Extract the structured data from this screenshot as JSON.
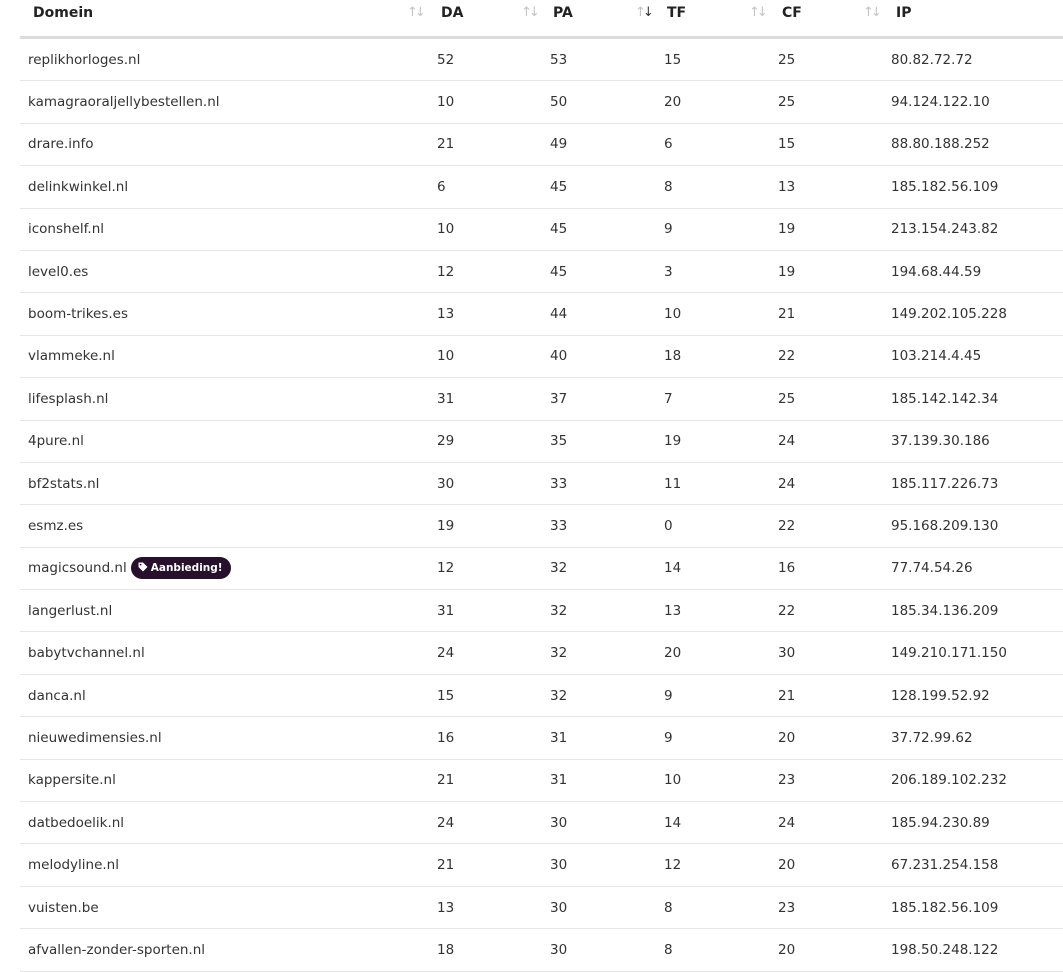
{
  "table": {
    "headers": {
      "domain": "Domein",
      "da": "DA",
      "pa": "PA",
      "tf": "TF",
      "cf": "CF",
      "ip": "IP"
    },
    "sort_icon_up": "↑",
    "sort_icon_down": "↓",
    "rows": [
      {
        "domain": "replikhorloges.nl",
        "da": "52",
        "pa": "53",
        "tf": "15",
        "cf": "25",
        "ip": "80.82.72.72"
      },
      {
        "domain": "kamagraoraljellybestellen.nl",
        "da": "10",
        "pa": "50",
        "tf": "20",
        "cf": "25",
        "ip": "94.124.122.10"
      },
      {
        "domain": "drare.info",
        "da": "21",
        "pa": "49",
        "tf": "6",
        "cf": "15",
        "ip": "88.80.188.252"
      },
      {
        "domain": "delinkwinkel.nl",
        "da": "6",
        "pa": "45",
        "tf": "8",
        "cf": "13",
        "ip": "185.182.56.109"
      },
      {
        "domain": "iconshelf.nl",
        "da": "10",
        "pa": "45",
        "tf": "9",
        "cf": "19",
        "ip": "213.154.243.82"
      },
      {
        "domain": "level0.es",
        "da": "12",
        "pa": "45",
        "tf": "3",
        "cf": "19",
        "ip": "194.68.44.59"
      },
      {
        "domain": "boom-trikes.es",
        "da": "13",
        "pa": "44",
        "tf": "10",
        "cf": "21",
        "ip": "149.202.105.228"
      },
      {
        "domain": "vlammeke.nl",
        "da": "10",
        "pa": "40",
        "tf": "18",
        "cf": "22",
        "ip": "103.214.4.45"
      },
      {
        "domain": "lifesplash.nl",
        "da": "31",
        "pa": "37",
        "tf": "7",
        "cf": "25",
        "ip": "185.142.142.34"
      },
      {
        "domain": "4pure.nl",
        "da": "29",
        "pa": "35",
        "tf": "19",
        "cf": "24",
        "ip": "37.139.30.186"
      },
      {
        "domain": "bf2stats.nl",
        "da": "30",
        "pa": "33",
        "tf": "11",
        "cf": "24",
        "ip": "185.117.226.73"
      },
      {
        "domain": "esmz.es",
        "da": "19",
        "pa": "33",
        "tf": "0",
        "cf": "22",
        "ip": "95.168.209.130"
      },
      {
        "domain": "magicsound.nl",
        "da": "12",
        "pa": "32",
        "tf": "14",
        "cf": "16",
        "ip": "77.74.54.26",
        "badge": "Aanbieding!"
      },
      {
        "domain": "langerlust.nl",
        "da": "31",
        "pa": "32",
        "tf": "13",
        "cf": "22",
        "ip": "185.34.136.209"
      },
      {
        "domain": "babytvchannel.nl",
        "da": "24",
        "pa": "32",
        "tf": "20",
        "cf": "30",
        "ip": "149.210.171.150"
      },
      {
        "domain": "danca.nl",
        "da": "15",
        "pa": "32",
        "tf": "9",
        "cf": "21",
        "ip": "128.199.52.92"
      },
      {
        "domain": "nieuwedimensies.nl",
        "da": "16",
        "pa": "31",
        "tf": "9",
        "cf": "20",
        "ip": "37.72.99.62"
      },
      {
        "domain": "kappersite.nl",
        "da": "21",
        "pa": "31",
        "tf": "10",
        "cf": "23",
        "ip": "206.189.102.232"
      },
      {
        "domain": "datbedoelik.nl",
        "da": "24",
        "pa": "30",
        "tf": "14",
        "cf": "24",
        "ip": "185.94.230.89"
      },
      {
        "domain": "melodyline.nl",
        "da": "21",
        "pa": "30",
        "tf": "12",
        "cf": "20",
        "ip": "67.231.254.158"
      },
      {
        "domain": "vuisten.be",
        "da": "13",
        "pa": "30",
        "tf": "8",
        "cf": "23",
        "ip": "185.182.56.109"
      },
      {
        "domain": "afvallen-zonder-sporten.nl",
        "da": "18",
        "pa": "30",
        "tf": "8",
        "cf": "20",
        "ip": "198.50.248.122"
      }
    ]
  },
  "colors": {
    "badge_bg": "#26102b",
    "badge_text": "#ffffff",
    "header_border": "#dcdcdc",
    "row_border": "#e6e6e6"
  },
  "icons": {
    "sort": "sort-arrows-icon",
    "badge": "tag-icon"
  }
}
